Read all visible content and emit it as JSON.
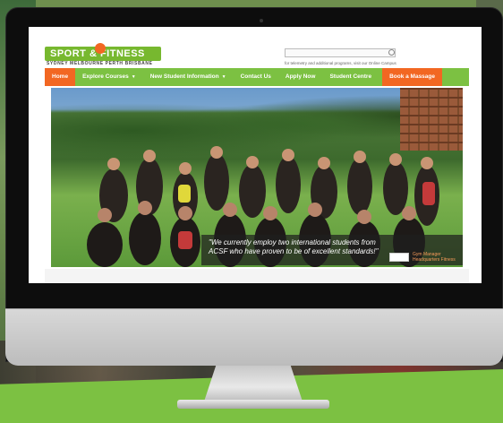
{
  "site": {
    "logo_text": "SPORT & FITNESS",
    "logo_cities": "SYDNEY   MELBOURNE   PERTH   BRISBANE",
    "search_placeholder": "",
    "tagline": "for telemetry and additional programs, visit our Online Campus"
  },
  "nav": {
    "items": [
      {
        "label": "Home",
        "active": true,
        "has_dropdown": false
      },
      {
        "label": "Explore Courses",
        "active": false,
        "has_dropdown": true
      },
      {
        "label": "New Student Information",
        "active": false,
        "has_dropdown": true
      },
      {
        "label": "Contact Us",
        "active": false,
        "has_dropdown": false
      },
      {
        "label": "Apply Now",
        "active": false,
        "has_dropdown": false
      },
      {
        "label": "Student Centre",
        "active": false,
        "has_dropdown": false
      }
    ],
    "cta_label": "Book a Massage",
    "caret": "▼"
  },
  "hero": {
    "quote": "\"We currently employ two international students from ACSF who have proven to be of excellent standards!\"",
    "author_line1": "Gym Manager",
    "author_line2": "Headquarters Fitness"
  },
  "colors": {
    "brand_green": "#7cc142",
    "brand_orange": "#f26722",
    "monitor_bezel": "#0d0d0d"
  }
}
